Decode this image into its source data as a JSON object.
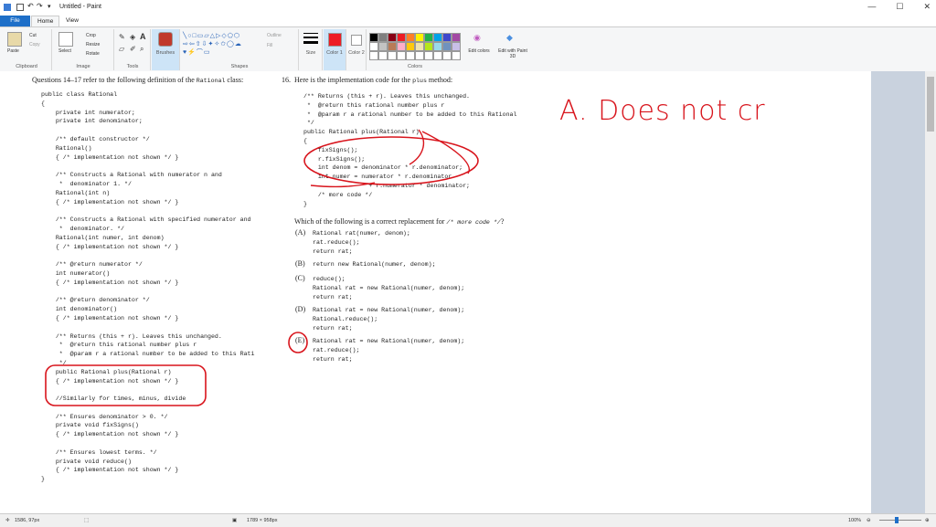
{
  "window": {
    "title": "Untitled - Paint"
  },
  "tabs": {
    "file": "File",
    "home": "Home",
    "view": "View"
  },
  "ribbon": {
    "clipboard": {
      "paste": "Paste",
      "cut": "Cut",
      "copy": "Copy",
      "label": "Clipboard"
    },
    "image": {
      "select": "Select",
      "crop": "Crop",
      "resize": "Resize",
      "rotate": "Rotate",
      "label": "Image"
    },
    "tools": {
      "label": "Tools"
    },
    "brushes": {
      "label": "Brushes"
    },
    "shapes": {
      "outline": "Outline",
      "fill": "Fill",
      "label": "Shapes"
    },
    "size": {
      "label": "Size"
    },
    "color1": {
      "label": "Color 1"
    },
    "color2": {
      "label": "Color 2"
    },
    "colors": {
      "label": "Colors",
      "edit": "Edit colors",
      "edit3d": "Edit with Paint 3D",
      "palette_row1": [
        "#000000",
        "#7f7f7f",
        "#880015",
        "#ed1c24",
        "#ff7f27",
        "#fff200",
        "#22b14c",
        "#00a2e8",
        "#3f48cc",
        "#a349a4"
      ],
      "palette_row2": [
        "#ffffff",
        "#c3c3c3",
        "#b97a57",
        "#ffaec9",
        "#ffc90e",
        "#efe4b0",
        "#b5e61d",
        "#99d9ea",
        "#7092be",
        "#c8bfe7"
      ],
      "color1_value": "#ed1c24",
      "color2_value": "#ffffff"
    }
  },
  "doc": {
    "left_header": "Questions 14–17 refer to the following definition of the ",
    "left_header_code": "Rational",
    "left_header_end": " class:",
    "left_code": [
      "public class Rational",
      "{",
      "    private int numerator;",
      "    private int denominator;",
      "",
      "    /** default constructor */",
      "    Rational()",
      "    { /* implementation not shown */ }",
      "",
      "    /** Constructs a Rational with numerator n and",
      "     *  denominator 1. */",
      "    Rational(int n)",
      "    { /* implementation not shown */ }",
      "",
      "    /** Constructs a Rational with specified numerator and",
      "     *  denominator. */",
      "    Rational(int numer, int denom)",
      "    { /* implementation not shown */ }",
      "",
      "    /** @return numerator */",
      "    int numerator()",
      "    { /* implementation not shown */ }",
      "",
      "    /** @return denominator */",
      "    int denominator()",
      "    { /* implementation not shown */ }",
      "",
      "    /** Returns (this + r). Leaves this unchanged.",
      "     *  @return this rational number plus r",
      "     *  @param r a rational number to be added to this Rati",
      "     */",
      "    public Rational plus(Rational r)",
      "    { /* implementation not shown */ }",
      "",
      "    //Similarly for times, minus, divide",
      "",
      "    /** Ensures denominator > 0. */",
      "    private void fixSigns()",
      "    { /* implementation not shown */ }",
      "",
      "    /** Ensures lowest terms. */",
      "    private void reduce()",
      "    { /* implementation not shown */ }",
      "}"
    ],
    "q_number": "16.",
    "q_text": "Here is the implementation code for the ",
    "q_code": "plus",
    "q_text_end": " method:",
    "right_code": [
      "/** Returns (this + r). Leaves this unchanged.",
      " *  @return this rational number plus r",
      " *  @param r a rational number to be added to this Rational",
      " */",
      "public Rational plus(Rational r)",
      "{",
      "    fixSigns();",
      "    r.fixSigns();",
      "    int denom = denominator * r.denominator;",
      "    int numer = numerator * r.denominator",
      "                  + r.numerator * denominator;",
      "    /* more code */",
      "}"
    ],
    "which_text": "Which of the following is a correct replacement for ",
    "which_code": "/* more code */",
    "which_end": "?",
    "choices": [
      {
        "letter": "(A)",
        "lines": [
          "Rational rat(numer, denom);",
          "rat.reduce();",
          "return rat;"
        ]
      },
      {
        "letter": "(B)",
        "lines": [
          "return new Rational(numer, denom);"
        ]
      },
      {
        "letter": "(C)",
        "lines": [
          "reduce();",
          "Rational rat = new Rational(numer, denom);",
          "return rat;"
        ]
      },
      {
        "letter": "(D)",
        "lines": [
          "Rational rat = new Rational(numer, denom);",
          "Rational.reduce();",
          "return rat;"
        ]
      },
      {
        "letter": "(E)",
        "lines": [
          "Rational rat = new Rational(numer, denom);",
          "rat.reduce();",
          "return rat;"
        ]
      }
    ],
    "handwriting": "A. Does not cr"
  },
  "status": {
    "cursor": "1586, 97px",
    "size": "1789 × 958px",
    "zoom": "100%"
  }
}
